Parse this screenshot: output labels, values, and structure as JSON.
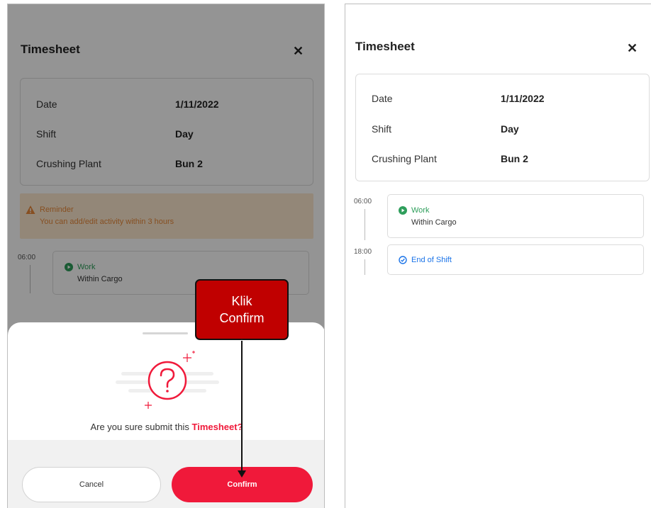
{
  "left_panel": {
    "title": "Timesheet",
    "close_icon": "close-icon",
    "info": [
      {
        "label": "Date",
        "value": "1/11/2022"
      },
      {
        "label": "Shift",
        "value": "Day"
      },
      {
        "label": "Crushing Plant",
        "value": "Bun 2"
      }
    ],
    "reminder": {
      "icon": "warning-icon",
      "title": "Reminder",
      "text": "You can add/edit activity within 3 hours"
    },
    "timeline": [
      {
        "time": "06:00",
        "title": "Work",
        "subtitle": "Within Cargo",
        "icon": "play-circle-icon"
      }
    ],
    "dialog": {
      "icon": "question-icon",
      "question_prefix": "Are you sure submit this ",
      "question_highlight": "Timesheet",
      "question_suffix": "?",
      "cancel_label": "Cancel",
      "confirm_label": "Confirm"
    },
    "callout": {
      "line1": "Klik",
      "line2": "Confirm"
    }
  },
  "right_panel": {
    "title": "Timesheet",
    "close_icon": "close-icon",
    "info": [
      {
        "label": "Date",
        "value": "1/11/2022"
      },
      {
        "label": "Shift",
        "value": "Day"
      },
      {
        "label": "Crushing Plant",
        "value": "Bun 2"
      }
    ],
    "timeline": [
      {
        "time": "06:00",
        "title": "Work",
        "subtitle": "Within Cargo",
        "icon": "play-circle-icon"
      },
      {
        "time": "18:00",
        "title": "End of Shift",
        "subtitle": "",
        "icon": "check-circle-icon"
      }
    ]
  },
  "colors": {
    "accent_red": "#f0193a",
    "work_green": "#2e9e5b",
    "end_blue": "#1a73e8",
    "reminder_bg": "#fde9cf",
    "reminder_text": "#e8893a",
    "callout_bg": "#c00000"
  }
}
